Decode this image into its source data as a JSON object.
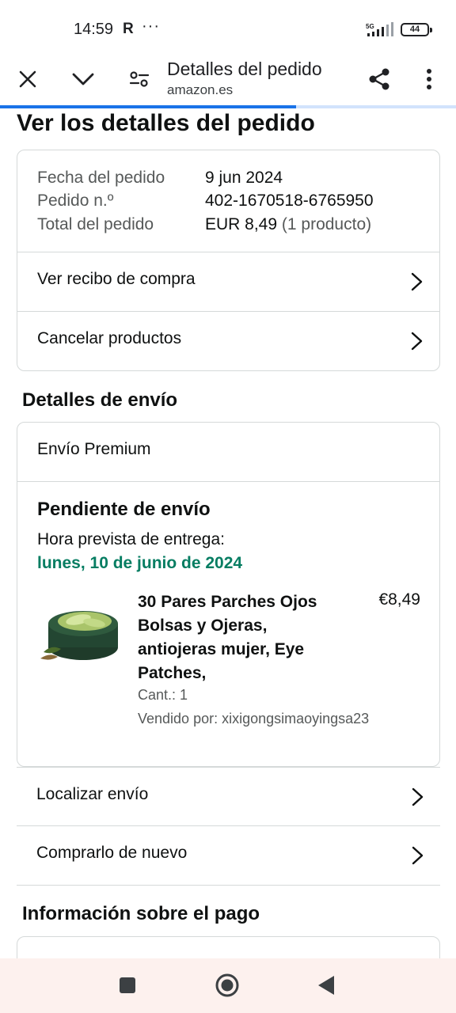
{
  "status_bar": {
    "time": "14:59",
    "carrier_icon": "R",
    "more": "···",
    "network": "5G",
    "battery": "44"
  },
  "toolbar": {
    "close_icon": "close-icon",
    "collapse_icon": "chevron-down-icon",
    "filter_icon": "page-info-icon",
    "title": "Detalles del pedido",
    "url": "amazon.es",
    "share_icon": "share-icon",
    "menu_icon": "more-vert-icon",
    "load_progress": 0.65,
    "accent": "#1a73e8"
  },
  "page": {
    "title": "Ver los detalles del pedido"
  },
  "summary": {
    "order_date_label": "Fecha del pedido",
    "order_date_value": "9 jun 2024",
    "order_number_label": "Pedido n.º",
    "order_number_value": "402-1670518-6765950",
    "total_label": "Total del pedido",
    "total_value": "EUR 8,49",
    "total_count": "(1 producto)",
    "links": [
      {
        "label": "Ver recibo de compra"
      },
      {
        "label": "Cancelar productos"
      }
    ]
  },
  "shipping": {
    "section_title": "Detalles de envío",
    "type": "Envío Premium",
    "status": "Pendiente de envío",
    "eta_label": "Hora prevista de entrega:",
    "eta_date": "lunes, 10 de junio de 2024",
    "eta_color": "#067d62",
    "product": {
      "title": "30 Pares Parches Ojos Bolsas y Ojeras, antiojeras mujer, Eye Patches,",
      "price": "€8,49",
      "qty": "Cant.: 1",
      "seller": "Vendido por: xixigongsimaoyingsa23"
    },
    "links": [
      {
        "label": "Localizar envío"
      },
      {
        "label": "Comprarlo de nuevo"
      }
    ]
  },
  "payment": {
    "section_title": "Información sobre el pago"
  },
  "nav": {
    "recents_icon": "square-icon",
    "home_icon": "home-circle-icon",
    "back_icon": "back-triangle-icon"
  }
}
